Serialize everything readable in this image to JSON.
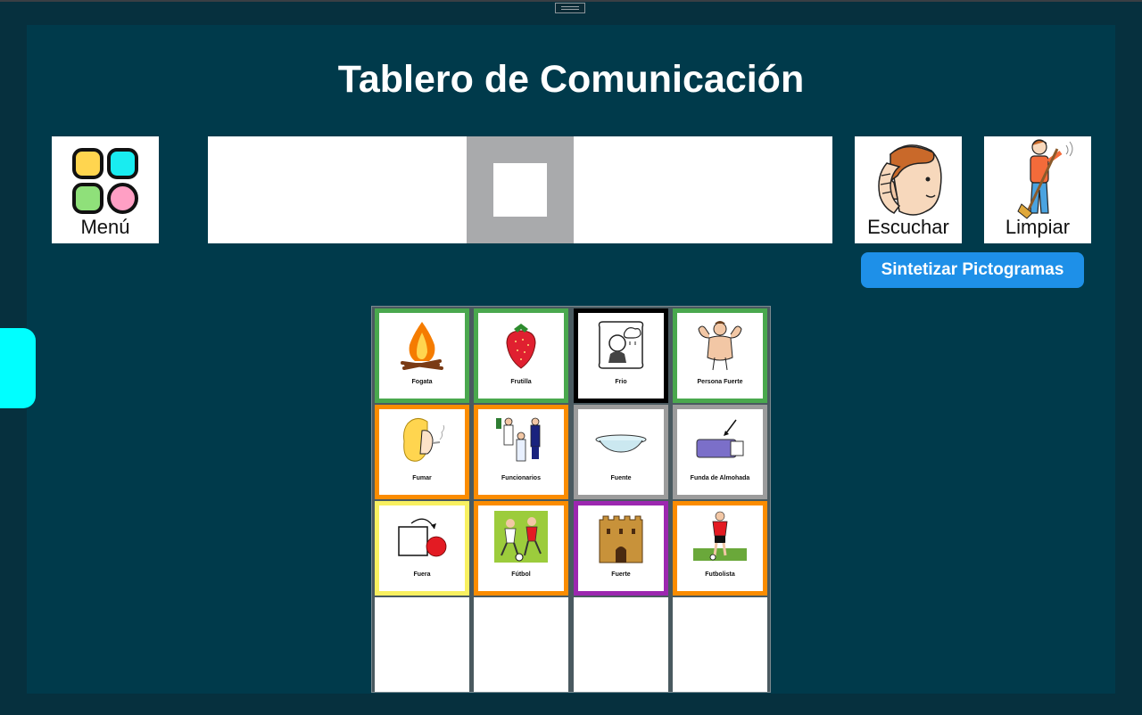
{
  "app": {
    "title": "Tablero de Comunicación"
  },
  "toolbar": {
    "menu_label": "Menú",
    "listen_label": "Escuchar",
    "clear_label": "Limpiar",
    "synthesize_label": "Sintetizar Pictogramas"
  },
  "colors": {
    "background": "#06303e",
    "panel": "#003a4b",
    "accent_button": "#1e90e8",
    "side_tab": "#00ffff"
  },
  "pictograms": [
    {
      "label": "Fogata",
      "border": "green",
      "icon": "campfire-icon"
    },
    {
      "label": "Frutilla",
      "border": "green",
      "icon": "strawberry-icon"
    },
    {
      "label": "Frio",
      "border": "black",
      "icon": "cold-person-icon"
    },
    {
      "label": "Persona Fuerte",
      "border": "green",
      "icon": "strong-person-icon"
    },
    {
      "label": "Fumar",
      "border": "orange",
      "icon": "smoking-icon"
    },
    {
      "label": "Funcionarios",
      "border": "orange",
      "icon": "officials-icon"
    },
    {
      "label": "Fuente",
      "border": "gray",
      "icon": "bowl-icon"
    },
    {
      "label": "Funda de Almohada",
      "border": "gray",
      "icon": "pillowcase-icon"
    },
    {
      "label": "Fuera",
      "border": "yellow",
      "icon": "outside-icon"
    },
    {
      "label": "Fútbol",
      "border": "orange",
      "icon": "football-icon"
    },
    {
      "label": "Fuerte",
      "border": "purple",
      "icon": "fortress-icon"
    },
    {
      "label": "Futbolista",
      "border": "orange",
      "icon": "footballer-icon"
    }
  ]
}
